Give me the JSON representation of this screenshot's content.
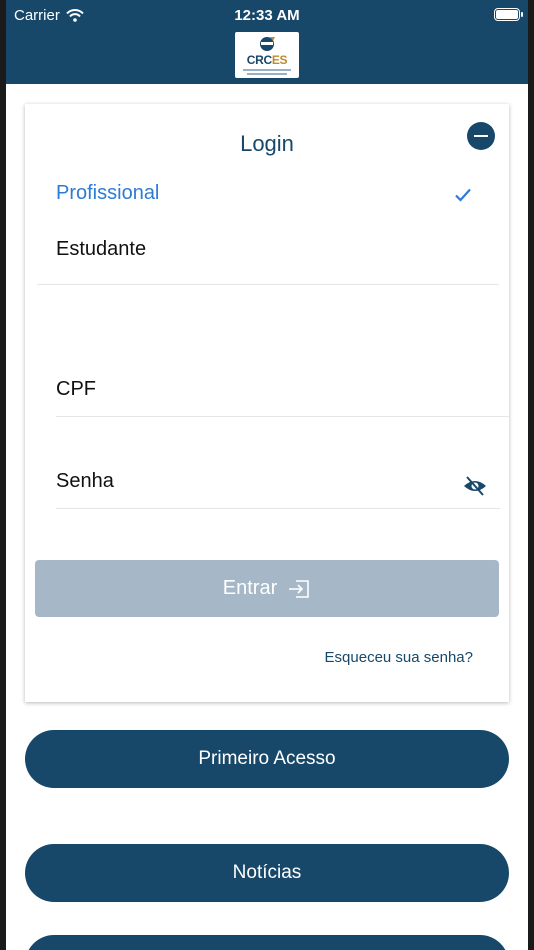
{
  "status_bar": {
    "carrier": "Carrier",
    "time": "12:33 AM"
  },
  "header": {
    "logo": {
      "crc": "CRC",
      "es": "ES"
    }
  },
  "login": {
    "title": "Login",
    "options": [
      "Profissional",
      "Estudante"
    ],
    "selected": "Profissional",
    "cpf_label": "CPF",
    "senha_label": "Senha",
    "entrar_label": "Entrar",
    "forgot_label": "Esqueceu sua senha?"
  },
  "buttons": {
    "primeiro_acesso": "Primeiro Acesso",
    "noticias": "Notícias"
  },
  "colors": {
    "primary": "#17486a",
    "accent": "#2e7bd6",
    "disabled": "#a6b8c8",
    "logo_gold": "#c08a2b"
  },
  "icons": [
    "wifi-icon",
    "battery-icon",
    "collapse-icon",
    "checkmark-icon",
    "eye-slash-icon",
    "enter-icon"
  ]
}
